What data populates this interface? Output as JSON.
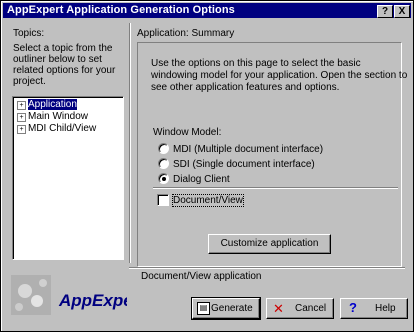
{
  "window": {
    "title": "AppExpert Application Generation Options",
    "help_btn": "?",
    "close_btn": "X"
  },
  "topics": {
    "label": "Topics:",
    "description": [
      "Select a topic from the",
      "outliner below to set",
      "related options for your",
      "project."
    ],
    "items": [
      {
        "label": "Application",
        "selected": true
      },
      {
        "label": "Main Window",
        "selected": false
      },
      {
        "label": "MDI Child/View",
        "selected": false
      }
    ]
  },
  "summary": {
    "label": "Application: Summary",
    "description": [
      "Use the options on this page to select the basic",
      "windowing model for your application.  Open the section to",
      "see other application features and options."
    ],
    "window_model": {
      "label": "Window Model:",
      "options": [
        {
          "label": "MDI (Multiple document interface)",
          "checked": false
        },
        {
          "label": "SDI (Single document interface)",
          "checked": false
        },
        {
          "label": "Dialog Client",
          "checked": true
        }
      ]
    },
    "docview": {
      "label": "Document/View",
      "checked": false
    },
    "customize_button": "Customize application",
    "status": "Document/View application"
  },
  "brand": {
    "logo_text": "AppExpert"
  },
  "buttons": {
    "generate": "Generate",
    "cancel": "Cancel",
    "help": "Help"
  },
  "colors": {
    "titlebar": "#000080",
    "face": "#c0c0c0",
    "logo_text": "#000080",
    "cancel_icon": "#cc0000",
    "help_icon": "#0000cc"
  }
}
